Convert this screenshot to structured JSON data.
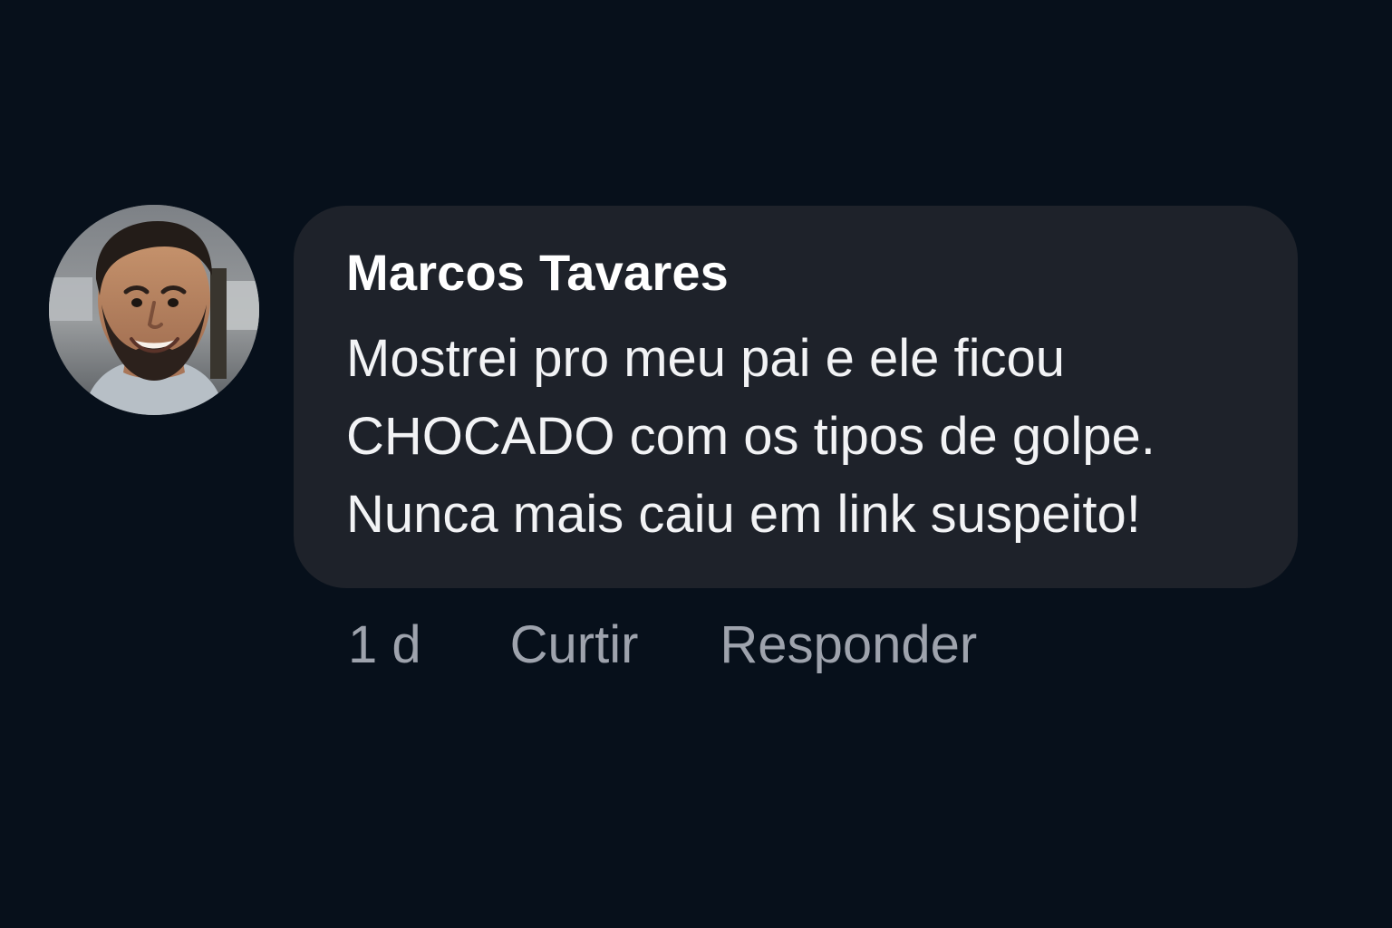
{
  "comment": {
    "avatar_icon": "user-avatar-photo",
    "author": "Marcos Tavares",
    "text_lines": [
      "Mostrei pro meu pai e ele ficou",
      "CHOCADO com os tipos de golpe.",
      "Nunca mais caiu em link suspeito!"
    ],
    "timestamp": "1 d",
    "like_label": "Curtir",
    "reply_label": "Responder"
  },
  "colors": {
    "background": "#07101b",
    "bubble": "#1e222a",
    "author": "#ffffff",
    "text": "#f2f3f5",
    "meta": "#9ea3ad"
  }
}
